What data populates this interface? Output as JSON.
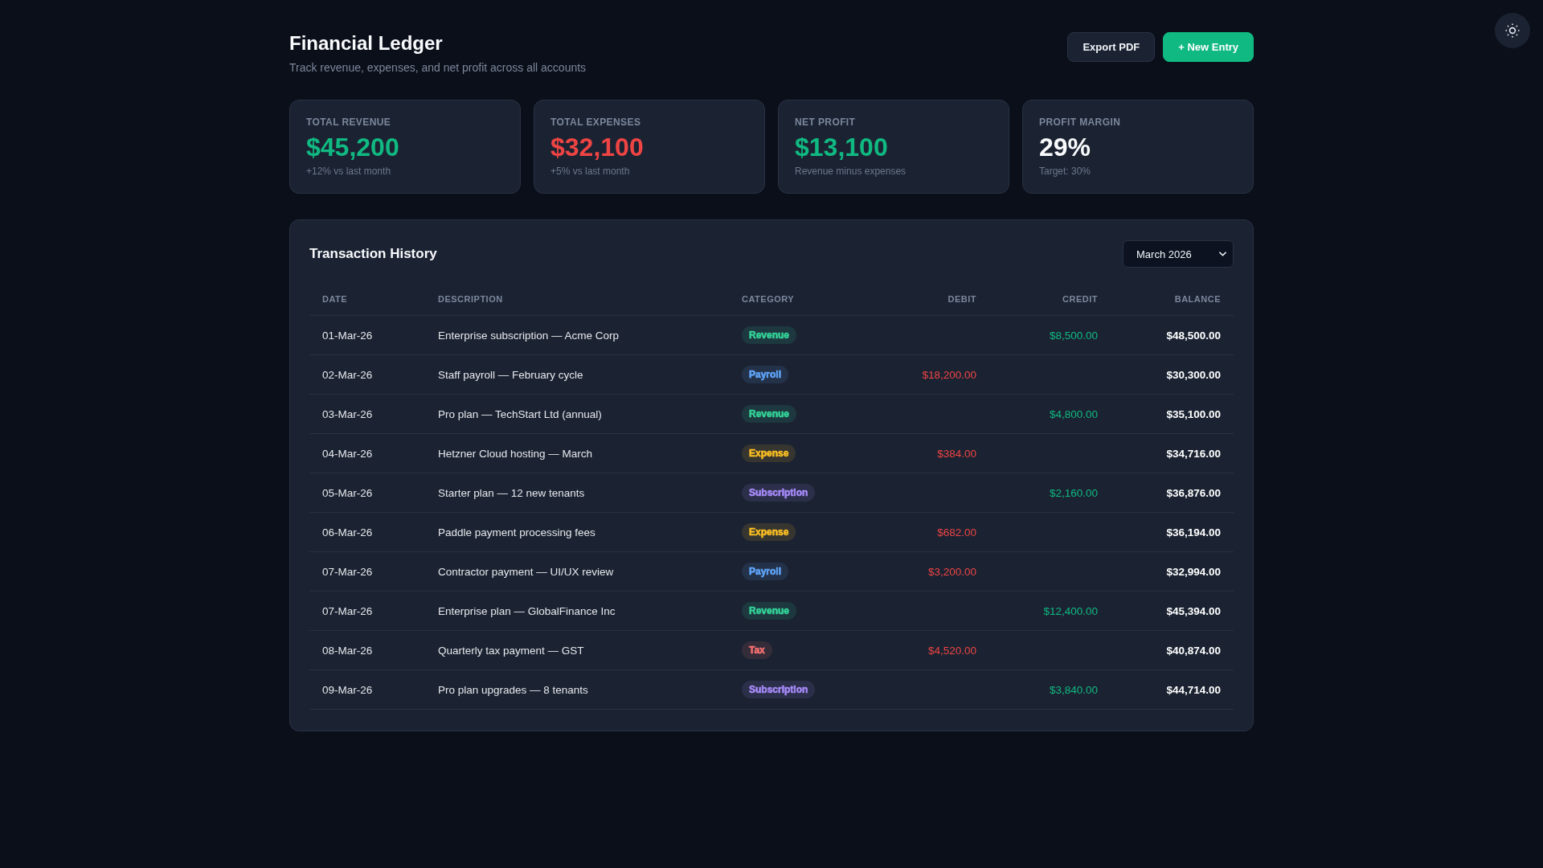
{
  "header": {
    "title": "Financial Ledger",
    "subtitle": "Track revenue, expenses, and net profit across all accounts"
  },
  "actions": [
    {
      "label": "Export PDF",
      "kind": "secondary"
    },
    {
      "label": "+ New Entry",
      "kind": "primary"
    }
  ],
  "stats": [
    {
      "label": "TOTAL REVENUE",
      "value": "$45,200",
      "note": "+12% vs last month",
      "color": "#10b981"
    },
    {
      "label": "TOTAL EXPENSES",
      "value": "$32,100",
      "note": "+5% vs last month",
      "color": "#ef4444"
    },
    {
      "label": "NET PROFIT",
      "value": "$13,100",
      "note": "Revenue minus expenses",
      "color": "#10b981"
    },
    {
      "label": "PROFIT MARGIN",
      "value": "29%",
      "note": "Target: 30%",
      "color": "#f8fafc"
    }
  ],
  "transactions": {
    "title": "Transaction History",
    "month_select": {
      "value": "March 2026"
    },
    "columns": [
      "DATE",
      "DESCRIPTION",
      "CATEGORY",
      "DEBIT",
      "CREDIT",
      "BALANCE"
    ],
    "rows": [
      {
        "date": "01-Mar-26",
        "description": "Enterprise subscription — Acme Corp",
        "category": {
          "label": "Revenue",
          "color": "#34d399"
        },
        "credit": "$8,500.00",
        "balance": "$48,500.00"
      },
      {
        "date": "02-Mar-26",
        "description": "Staff payroll — February cycle",
        "category": {
          "label": "Payroll",
          "color": "#60a5fa"
        },
        "debit": "$18,200.00",
        "balance": "$30,300.00"
      },
      {
        "date": "03-Mar-26",
        "description": "Pro plan — TechStart Ltd (annual)",
        "category": {
          "label": "Revenue",
          "color": "#34d399"
        },
        "credit": "$4,800.00",
        "balance": "$35,100.00"
      },
      {
        "date": "04-Mar-26",
        "description": "Hetzner Cloud hosting — March",
        "category": {
          "label": "Expense",
          "color": "#fbbf24"
        },
        "debit": "$384.00",
        "balance": "$34,716.00"
      },
      {
        "date": "05-Mar-26",
        "description": "Starter plan — 12 new tenants",
        "category": {
          "label": "Subscription",
          "color": "#a78bfa"
        },
        "credit": "$2,160.00",
        "balance": "$36,876.00"
      },
      {
        "date": "06-Mar-26",
        "description": "Paddle payment processing fees",
        "category": {
          "label": "Expense",
          "color": "#fbbf24"
        },
        "debit": "$682.00",
        "balance": "$36,194.00"
      },
      {
        "date": "07-Mar-26",
        "description": "Contractor payment — UI/UX review",
        "category": {
          "label": "Payroll",
          "color": "#60a5fa"
        },
        "debit": "$3,200.00",
        "balance": "$32,994.00"
      },
      {
        "date": "07-Mar-26",
        "description": "Enterprise plan — GlobalFinance Inc",
        "category": {
          "label": "Revenue",
          "color": "#34d399"
        },
        "credit": "$12,400.00",
        "balance": "$45,394.00"
      },
      {
        "date": "08-Mar-26",
        "description": "Quarterly tax payment — GST",
        "category": {
          "label": "Tax",
          "color": "#f87171"
        },
        "debit": "$4,520.00",
        "balance": "$40,874.00"
      },
      {
        "date": "09-Mar-26",
        "description": "Pro plan upgrades — 8 tenants",
        "category": {
          "label": "Subscription",
          "color": "#a78bfa"
        },
        "credit": "$3,840.00",
        "balance": "$44,714.00"
      }
    ]
  }
}
